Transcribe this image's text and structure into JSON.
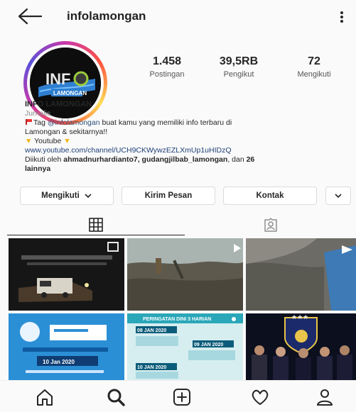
{
  "header": {
    "username": "infolamongan",
    "back_icon": "arrow-left-icon",
    "more_icon": "vertical-dots-icon"
  },
  "profile": {
    "avatar_logo_text": "INFO LAMONGAN",
    "stats": [
      {
        "value": "1.458",
        "label": "Postingan"
      },
      {
        "value": "39,5RB",
        "label": "Pengikut"
      },
      {
        "value": "72",
        "label": "Mengikuti"
      }
    ]
  },
  "bio": {
    "name": "INFO LAMONGAN",
    "category": "Jurnalis",
    "tag_prefix": "Tag ",
    "tag_handle": "@infolamongan",
    "tag_suffix": " buat kamu yang memiliki info terbaru di",
    "line2": "Lamongan & sekitarnya!!",
    "line3": "Youtube",
    "link": "www.youtube.com/channel/UCH9CKWywzEZLXmUp1uHIDzQ",
    "followed_prefix": "Diikuti oleh ",
    "followed_names": "ahmadnurhardianto7, gudangjilbab_lamongan",
    "followed_mid": ", dan ",
    "followed_count": "26",
    "followed_more": "lainnya"
  },
  "actions": {
    "following_label": "Mengikuti",
    "message_label": "Kirim Pesan",
    "contact_label": "Kontak"
  },
  "tabs": {
    "grid_icon": "grid-icon",
    "tagged_icon": "tagged-person-icon"
  },
  "posts": {
    "info_date_1": "08 JAN 2020",
    "info_date_2": "09 JAN 2020",
    "info_date_3": "10 JAN 2020",
    "warning_title": "PERINGATAN DINI 3 HARIAN",
    "tile4_date": "10 Jan 2020"
  },
  "bottom_nav": [
    "home-icon",
    "search-icon",
    "add-post-icon",
    "activity-heart-icon",
    "profile-icon"
  ],
  "colors": {
    "accent_link": "#1d3f78",
    "tab_active": "#262626"
  }
}
